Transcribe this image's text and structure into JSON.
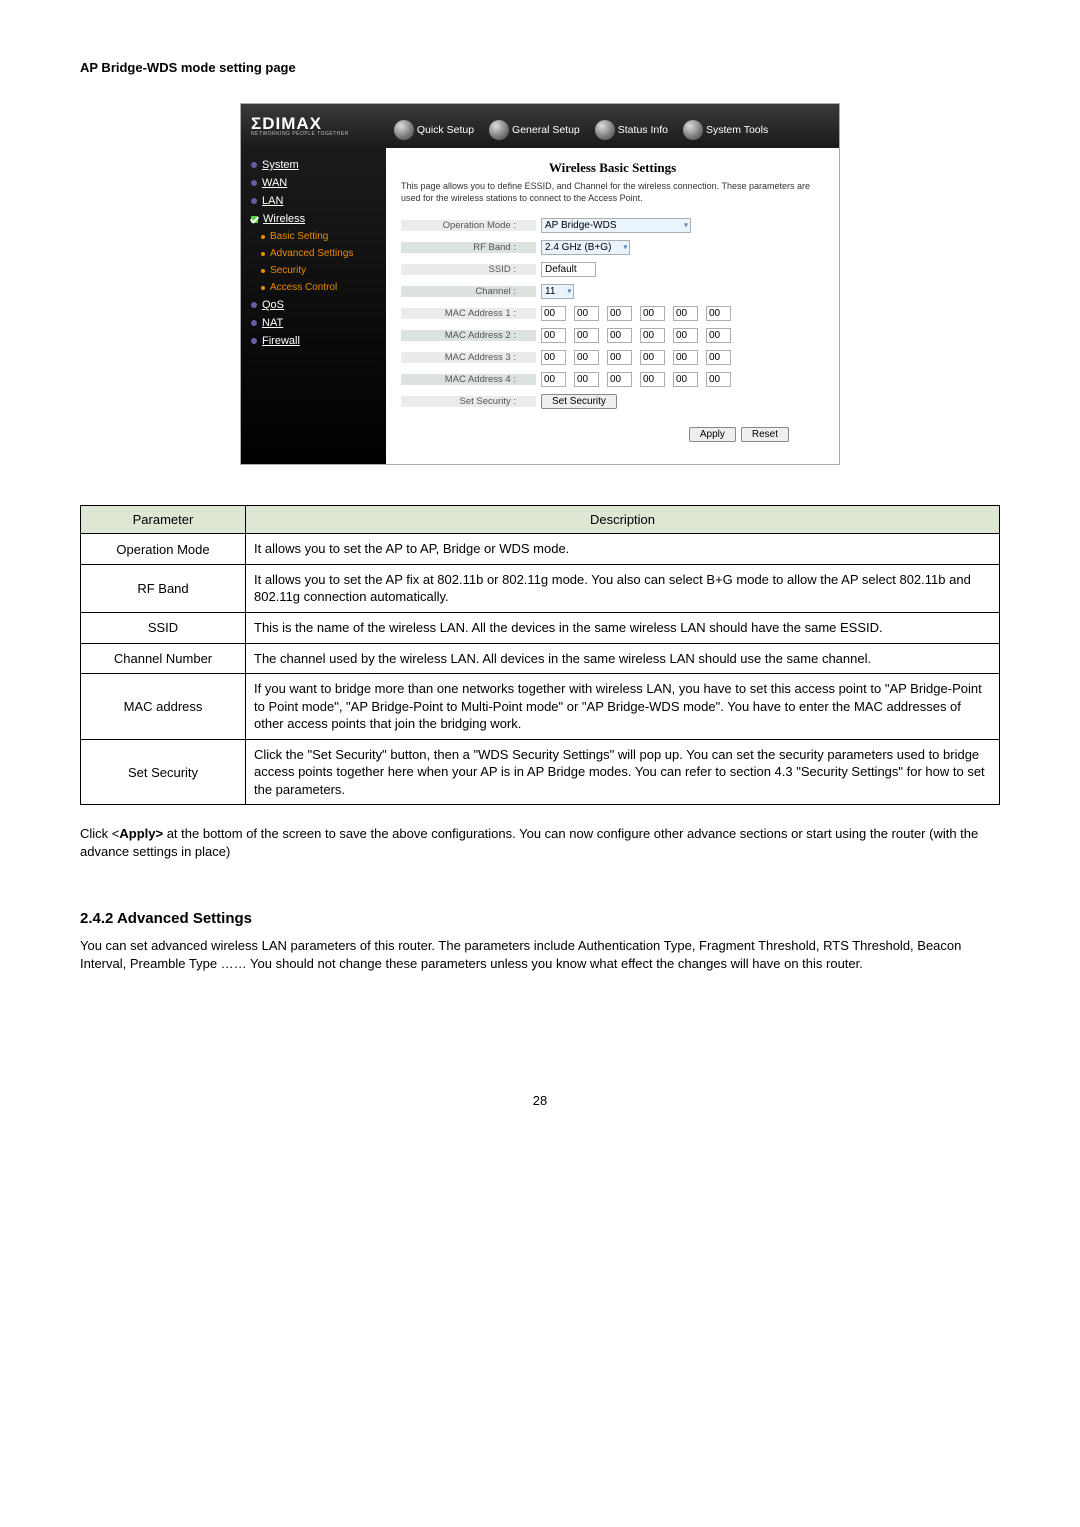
{
  "doc": {
    "heading": "AP Bridge-WDS mode setting page",
    "after_intro": "Click <",
    "after_bold": "Apply>",
    "after_rest": " at the bottom of the screen to save the above configurations. You can now configure other advance sections or start using the router (with the advance settings in place)",
    "section_num_head": "2.4.2 Advanced Settings",
    "section_body": "You can set advanced wireless LAN parameters of this router. The parameters include Authentication Type, Fragment Threshold, RTS Threshold, Beacon Interval, Preamble Type …… You should not change these parameters unless you know what effect the changes will have on this router.",
    "page_number": "28"
  },
  "screenshot": {
    "logo": "ΣDIMAX",
    "logo_tag": "NETWORKING PEOPLE TOGETHER",
    "tabs": [
      "Quick Setup",
      "General Setup",
      "Status Info",
      "System Tools"
    ],
    "sidebar": {
      "main": [
        "System",
        "WAN",
        "LAN",
        "Wireless",
        "QoS",
        "NAT",
        "Firewall"
      ],
      "wireless_subs": [
        "Basic Setting",
        "Advanced Settings",
        "Security",
        "Access Control"
      ]
    },
    "main": {
      "title": "Wireless Basic Settings",
      "desc": "This page allows you to define ESSID, and Channel for the wireless connection. These parameters are used for the wireless stations to connect to the Access Point.",
      "labels": {
        "op_mode": "Operation Mode :",
        "rf_band": "RF Band :",
        "ssid": "SSID :",
        "channel": "Channel :",
        "mac1": "MAC Address 1 :",
        "mac2": "MAC Address 2 :",
        "mac3": "MAC Address 3 :",
        "mac4": "MAC Address 4 :",
        "set_sec": "Set Security :"
      },
      "values": {
        "op_mode": "AP Bridge-WDS",
        "rf_band": "2.4 GHz (B+G)",
        "ssid": "Default",
        "channel": "11",
        "mac_part": "00",
        "set_sec_btn": "Set Security",
        "apply": "Apply",
        "reset": "Reset"
      }
    }
  },
  "table": {
    "headers": {
      "param": "Parameter",
      "desc": "Description"
    },
    "rows": [
      {
        "p": "Operation Mode",
        "d": "It allows you to set the AP to AP, Bridge or WDS mode."
      },
      {
        "p": "RF Band",
        "d": "It allows you to set the AP fix at 802.11b or 802.11g mode. You also can select B+G mode to allow the AP select 802.11b and 802.11g connection automatically."
      },
      {
        "p": "SSID",
        "d": "This is the name of the wireless LAN. All the devices in the same wireless LAN should have the same ESSID."
      },
      {
        "p": "Channel Number",
        "d": "The channel used by the wireless LAN. All devices in the same wireless LAN should use the same channel."
      },
      {
        "p": "MAC address",
        "d": "If you want to bridge more than one networks together with wireless LAN, you have to set this access point to \"AP Bridge-Point to Point mode\", \"AP Bridge-Point to Multi-Point mode\" or \"AP Bridge-WDS mode\". You have to enter the MAC addresses of other access points that join the bridging work."
      },
      {
        "p": "Set Security",
        "d": "Click the \"Set Security\" button, then a \"WDS Security Settings\" will pop up. You can set the security parameters used to bridge access points together here when your AP is in AP Bridge modes. You can refer to section 4.3 \"Security Settings\" for how to set the parameters."
      }
    ]
  }
}
